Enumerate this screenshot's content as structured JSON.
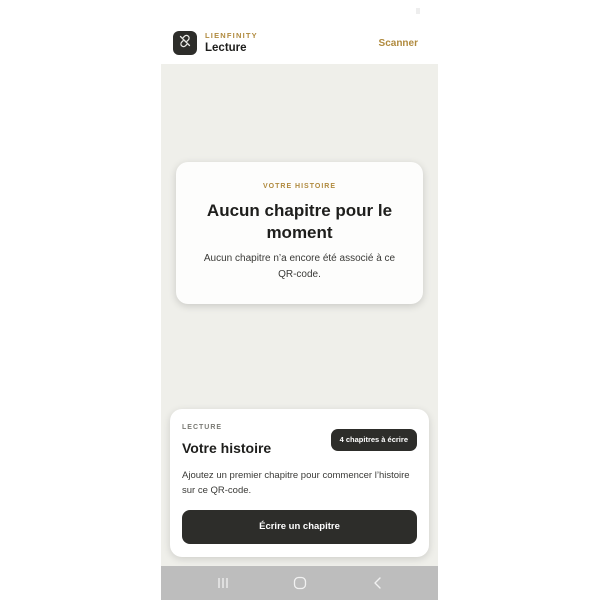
{
  "header": {
    "brand": "LIENFINITY",
    "title": "Lecture",
    "scanner_label": "Scanner",
    "logo_icon": "broken-link-icon"
  },
  "story_card": {
    "eyebrow": "VOTRE HISTOIRE",
    "headline": "Aucun chapitre pour le moment",
    "description": "Aucun chapitre n’a encore été associé à ce QR-code."
  },
  "reading_card": {
    "section_label": "LECTURE",
    "title": "Votre histoire",
    "badge": "4 chapitres à écrire",
    "body": "Ajoutez un premier chapitre pour commencer l’histoire sur ce QR-code.",
    "cta_label": "Écrire un chapitre"
  },
  "navigation": {
    "items": [
      "recent-apps-icon",
      "home-icon",
      "back-icon"
    ]
  },
  "colors": {
    "accent": "#b08a3e",
    "dark": "#2d2d2a",
    "background": "#efefea",
    "nav_bar": "#bdbdbd"
  }
}
